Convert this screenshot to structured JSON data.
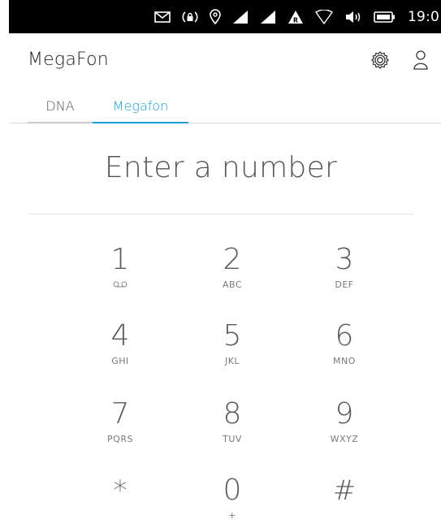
{
  "status_bar": {
    "time": "19:0",
    "icons": [
      "mail-icon",
      "alarm-lock-icon",
      "location-pin-icon",
      "signal-icon",
      "signal-icon",
      "roaming-signal-icon",
      "wifi-icon",
      "volume-icon",
      "battery-icon"
    ]
  },
  "header": {
    "title": "MegaFon",
    "actions": [
      "settings-icon",
      "contacts-icon"
    ]
  },
  "tabs": [
    {
      "label": "DNA",
      "active": false
    },
    {
      "label": "Megafon",
      "active": true
    }
  ],
  "number_entry": {
    "placeholder": "Enter a number"
  },
  "keypad": {
    "keys": [
      {
        "digit": "1",
        "letters": "",
        "icon": "voicemail-icon"
      },
      {
        "digit": "2",
        "letters": "ABC"
      },
      {
        "digit": "3",
        "letters": "DEF"
      },
      {
        "digit": "4",
        "letters": "GHI"
      },
      {
        "digit": "5",
        "letters": "JKL"
      },
      {
        "digit": "6",
        "letters": "MNO"
      },
      {
        "digit": "7",
        "letters": "PQRS"
      },
      {
        "digit": "8",
        "letters": "TUV"
      },
      {
        "digit": "9",
        "letters": "WXYZ"
      },
      {
        "digit": "*",
        "letters": ""
      },
      {
        "digit": "0",
        "letters": "+"
      },
      {
        "digit": "#",
        "letters": ""
      }
    ]
  },
  "colors": {
    "accent": "#1a9bd3",
    "status_bar_bg": "#000000",
    "text_primary": "#222222",
    "text_secondary": "#5a5a5a"
  }
}
